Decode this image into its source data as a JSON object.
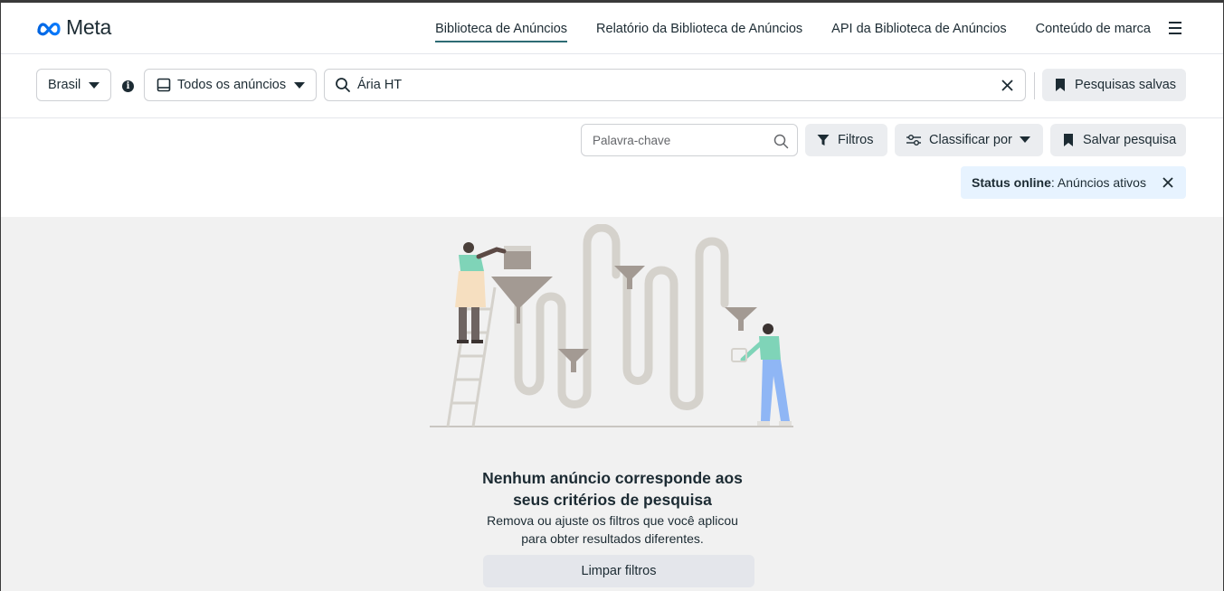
{
  "header": {
    "logo_text": "Meta",
    "nav": [
      {
        "label": "Biblioteca de Anúncios",
        "active": true
      },
      {
        "label": "Relatório da Biblioteca de Anúncios",
        "active": false
      },
      {
        "label": "API da Biblioteca de Anúncios",
        "active": false
      },
      {
        "label": "Conteúdo de marca",
        "active": false
      }
    ]
  },
  "search": {
    "country": "Brasil",
    "ad_type": "Todos os anúncios",
    "query": "Ária HT",
    "saved_searches_label": "Pesquisas salvas"
  },
  "toolbar": {
    "keyword_placeholder": "Palavra-chave",
    "filters_label": "Filtros",
    "sort_label": "Classificar por",
    "save_search_label": "Salvar pesquisa"
  },
  "status_filter": {
    "key": "Status online",
    "value": ": Anúncios ativos"
  },
  "empty_state": {
    "title_line1": "Nenhum anúncio corresponde aos",
    "title_line2": "seus critérios de pesquisa",
    "desc_line1": "Remova ou ajuste os filtros que você aplicou",
    "desc_line2": "para obter resultados diferentes.",
    "clear_button": "Limpar filtros"
  },
  "colors": {
    "accent_underline": "#2d6b74",
    "chip_bg": "#e7f3ff",
    "button_bg": "#ebedf0",
    "content_bg": "#f1f1f1"
  }
}
